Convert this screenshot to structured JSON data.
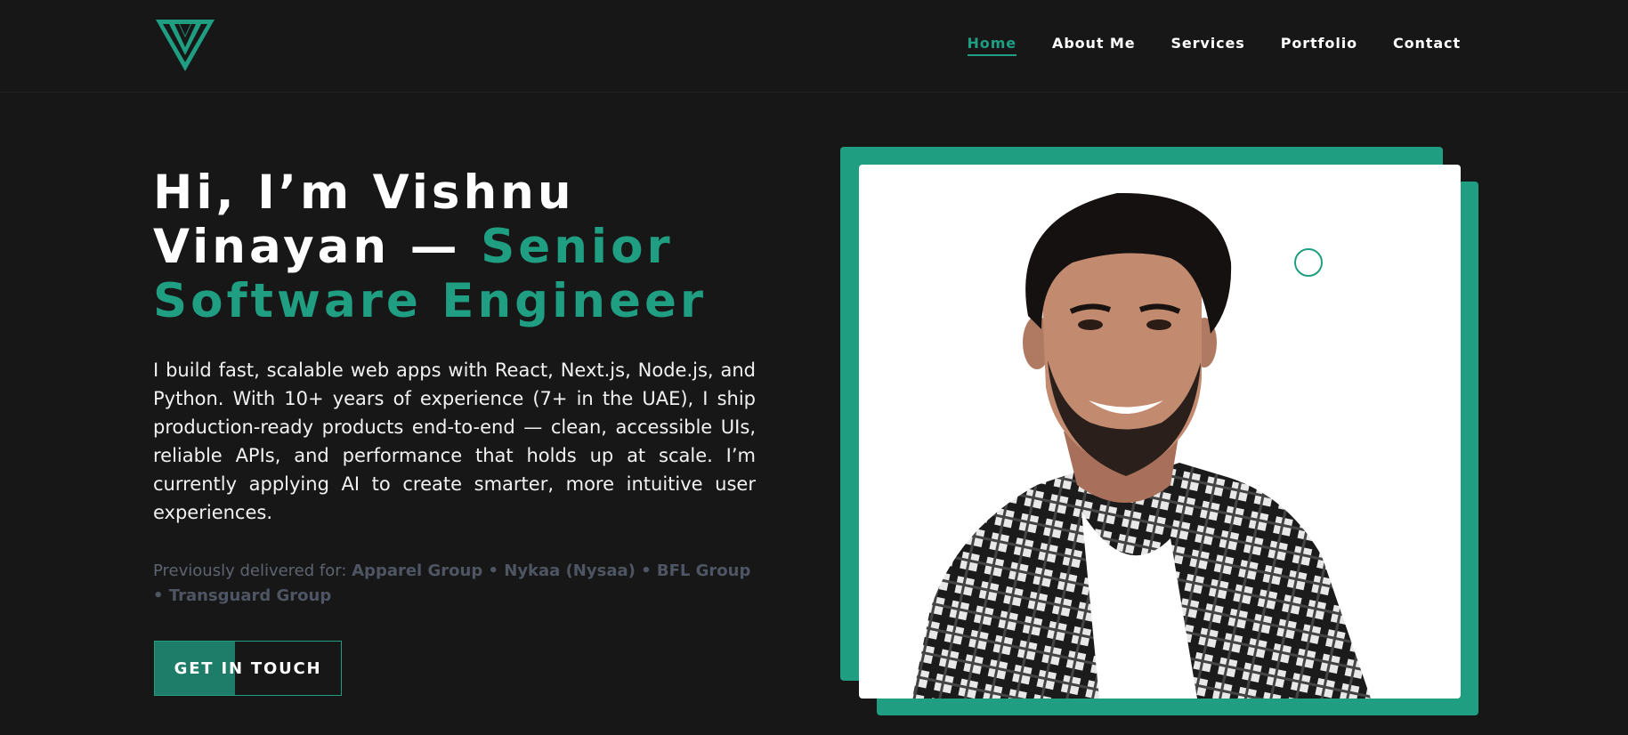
{
  "brand": {
    "logo_icon": "v-logo-icon",
    "accent_color": "#1f9e82"
  },
  "nav": {
    "items": [
      {
        "label": "Home",
        "active": true
      },
      {
        "label": "About Me",
        "active": false
      },
      {
        "label": "Services",
        "active": false
      },
      {
        "label": "Portfolio",
        "active": false
      },
      {
        "label": "Contact",
        "active": false
      }
    ]
  },
  "hero": {
    "title_part1": "Hi, I’m Vishnu Vinayan — ",
    "title_accent": "Senior Software Engineer",
    "description": "I build fast, scalable web apps with React, Next.js, Node.js, and Python. With 10+ years of experience (7+ in the UAE), I ship production-ready products end-to-end — clean, accessible UIs, reliable APIs, and performance that holds up at scale. I’m currently applying AI to create smarter, more intuitive user experiences.",
    "delivered_prefix": "Previously delivered for: ",
    "delivered_clients": "Apparel Group • Nykaa (Nysaa) • BFL Group • Transguard Group",
    "cta_label": "GET IN TOUCH"
  },
  "photo": {
    "subject": "portrait-photo",
    "decor": "ring-icon"
  }
}
